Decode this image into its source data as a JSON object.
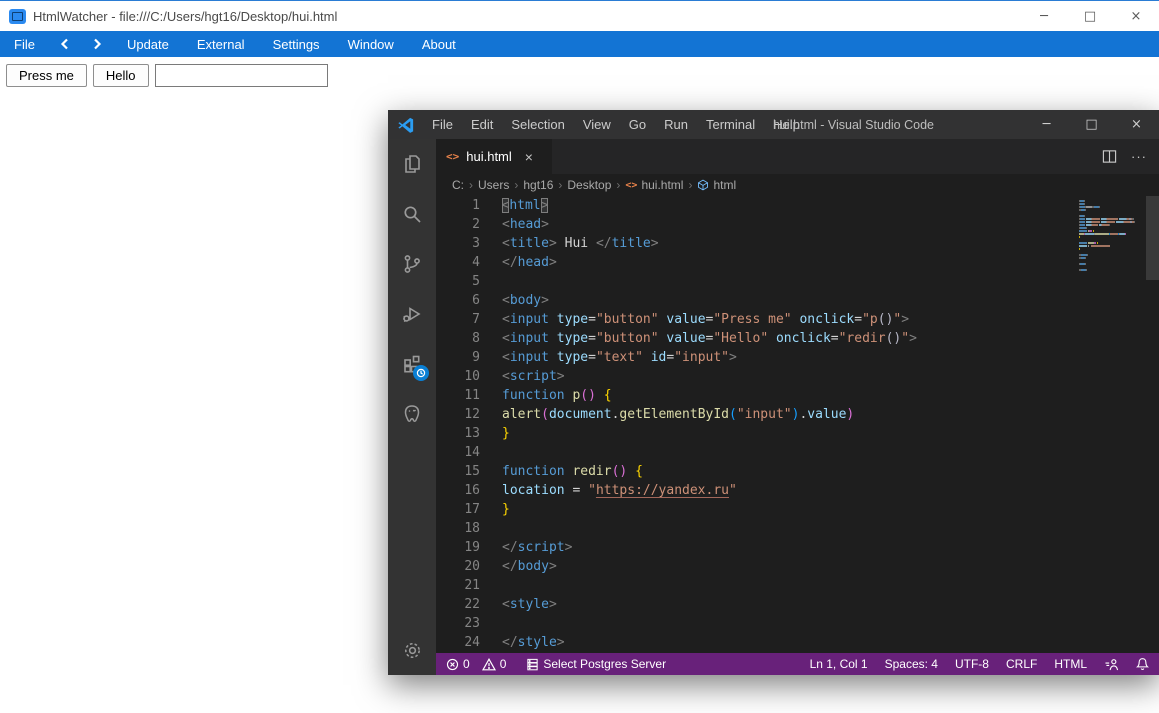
{
  "htmlwatcher": {
    "title": "HtmlWatcher - file:///C:/Users/hgt16/Desktop/hui.html",
    "menu_items": [
      "File",
      "Update",
      "External",
      "Settings",
      "Window",
      "About"
    ],
    "buttons": {
      "press_me": "Press me",
      "hello": "Hello"
    },
    "text_input": {
      "value": "",
      "placeholder": ""
    },
    "window_controls": {
      "minimize": "─",
      "maximize": "□",
      "close": "×"
    },
    "accent_color": "#1374D4"
  },
  "vscode": {
    "window_title": "hui.html - Visual Studio Code",
    "menu_items": [
      "File",
      "Edit",
      "Selection",
      "View",
      "Go",
      "Run",
      "Terminal",
      "Help"
    ],
    "tab": {
      "label": "hui.html",
      "close": "×",
      "more_actions": "···"
    },
    "breadcrumb": [
      "C:",
      "Users",
      "hgt16",
      "Desktop",
      "hui.html",
      "html"
    ],
    "breadcrumb_separator": "›",
    "window_controls": {
      "minimize": "─",
      "maximize": "□",
      "close": "×"
    },
    "status_bar": {
      "errors": "0",
      "warnings": "0",
      "postgres_label": "Select Postgres Server",
      "ln_col": "Ln 1, Col 1",
      "spaces": "Spaces: 4",
      "encoding": "UTF-8",
      "eol": "CRLF",
      "language": "HTML",
      "background": "#68217A"
    },
    "editor": {
      "theme_background": "#1E1E1E",
      "code_lines": [
        [
          [
            "punct match",
            "<"
          ],
          [
            "tag",
            "html"
          ],
          [
            "punct match",
            ">"
          ]
        ],
        [
          [
            "punct",
            "<"
          ],
          [
            "tag",
            "head"
          ],
          [
            "punct",
            ">"
          ]
        ],
        [
          [
            "punct",
            "<"
          ],
          [
            "tag",
            "title"
          ],
          [
            "punct",
            ">"
          ],
          [
            "plain",
            " Hui "
          ],
          [
            "punct",
            "</"
          ],
          [
            "tag",
            "title"
          ],
          [
            "punct",
            ">"
          ]
        ],
        [
          [
            "punct",
            "</"
          ],
          [
            "tag",
            "head"
          ],
          [
            "punct",
            ">"
          ]
        ],
        [],
        [
          [
            "punct",
            "<"
          ],
          [
            "tag",
            "body"
          ],
          [
            "punct",
            ">"
          ]
        ],
        [
          [
            "punct",
            "<"
          ],
          [
            "tag",
            "input"
          ],
          [
            "plain",
            " "
          ],
          [
            "attr",
            "type"
          ],
          [
            "op",
            "="
          ],
          [
            "str",
            "\"button\""
          ],
          [
            "plain",
            " "
          ],
          [
            "attr",
            "value"
          ],
          [
            "op",
            "="
          ],
          [
            "str",
            "\"Press me\""
          ],
          [
            "plain",
            " "
          ],
          [
            "attr",
            "onclick"
          ],
          [
            "op",
            "="
          ],
          [
            "str",
            "\"p"
          ],
          [
            "jsp",
            "()"
          ],
          [
            "str",
            "\""
          ],
          [
            "punct",
            ">"
          ]
        ],
        [
          [
            "punct",
            "<"
          ],
          [
            "tag",
            "input"
          ],
          [
            "plain",
            " "
          ],
          [
            "attr",
            "type"
          ],
          [
            "op",
            "="
          ],
          [
            "str",
            "\"button\""
          ],
          [
            "plain",
            " "
          ],
          [
            "attr",
            "value"
          ],
          [
            "op",
            "="
          ],
          [
            "str",
            "\"Hello\""
          ],
          [
            "plain",
            " "
          ],
          [
            "attr",
            "onclick"
          ],
          [
            "op",
            "="
          ],
          [
            "str",
            "\"redir"
          ],
          [
            "jsp",
            "()"
          ],
          [
            "str",
            "\""
          ],
          [
            "punct",
            ">"
          ]
        ],
        [
          [
            "punct",
            "<"
          ],
          [
            "tag",
            "input"
          ],
          [
            "plain",
            " "
          ],
          [
            "attr",
            "type"
          ],
          [
            "op",
            "="
          ],
          [
            "str",
            "\"text\""
          ],
          [
            "plain",
            " "
          ],
          [
            "attr",
            "id"
          ],
          [
            "op",
            "="
          ],
          [
            "str",
            "\"input\""
          ],
          [
            "punct",
            ">"
          ]
        ],
        [
          [
            "punct",
            "<"
          ],
          [
            "tag",
            "script"
          ],
          [
            "punct",
            ">"
          ]
        ],
        [
          [
            "kw",
            "function"
          ],
          [
            "plain",
            " "
          ],
          [
            "fn",
            "p"
          ],
          [
            "b2",
            "()"
          ],
          [
            "plain",
            " "
          ],
          [
            "b1",
            "{"
          ]
        ],
        [
          [
            "fn",
            "alert"
          ],
          [
            "b2",
            "("
          ],
          [
            "var",
            "document"
          ],
          [
            "op",
            "."
          ],
          [
            "fn",
            "getElementById"
          ],
          [
            "b3",
            "("
          ],
          [
            "str",
            "\"input\""
          ],
          [
            "b3",
            ")"
          ],
          [
            "op",
            "."
          ],
          [
            "var",
            "value"
          ],
          [
            "b2",
            ")"
          ]
        ],
        [
          [
            "b1",
            "}"
          ]
        ],
        [],
        [
          [
            "kw",
            "function"
          ],
          [
            "plain",
            " "
          ],
          [
            "fn",
            "redir"
          ],
          [
            "b2",
            "()"
          ],
          [
            "plain",
            " "
          ],
          [
            "b1",
            "{"
          ]
        ],
        [
          [
            "var",
            "location"
          ],
          [
            "plain",
            " "
          ],
          [
            "op",
            "="
          ],
          [
            "plain",
            " "
          ],
          [
            "str",
            "\""
          ],
          [
            "link",
            "https://yandex.ru"
          ],
          [
            "str",
            "\""
          ]
        ],
        [
          [
            "b1",
            "}"
          ]
        ],
        [],
        [
          [
            "punct",
            "</"
          ],
          [
            "tag",
            "script"
          ],
          [
            "punct",
            ">"
          ]
        ],
        [
          [
            "punct",
            "</"
          ],
          [
            "tag",
            "body"
          ],
          [
            "punct",
            ">"
          ]
        ],
        [],
        [
          [
            "punct",
            "<"
          ],
          [
            "tag",
            "style"
          ],
          [
            "punct",
            ">"
          ]
        ],
        [],
        [
          [
            "punct",
            "</"
          ],
          [
            "tag",
            "style"
          ],
          [
            "punct",
            ">"
          ]
        ]
      ]
    }
  }
}
